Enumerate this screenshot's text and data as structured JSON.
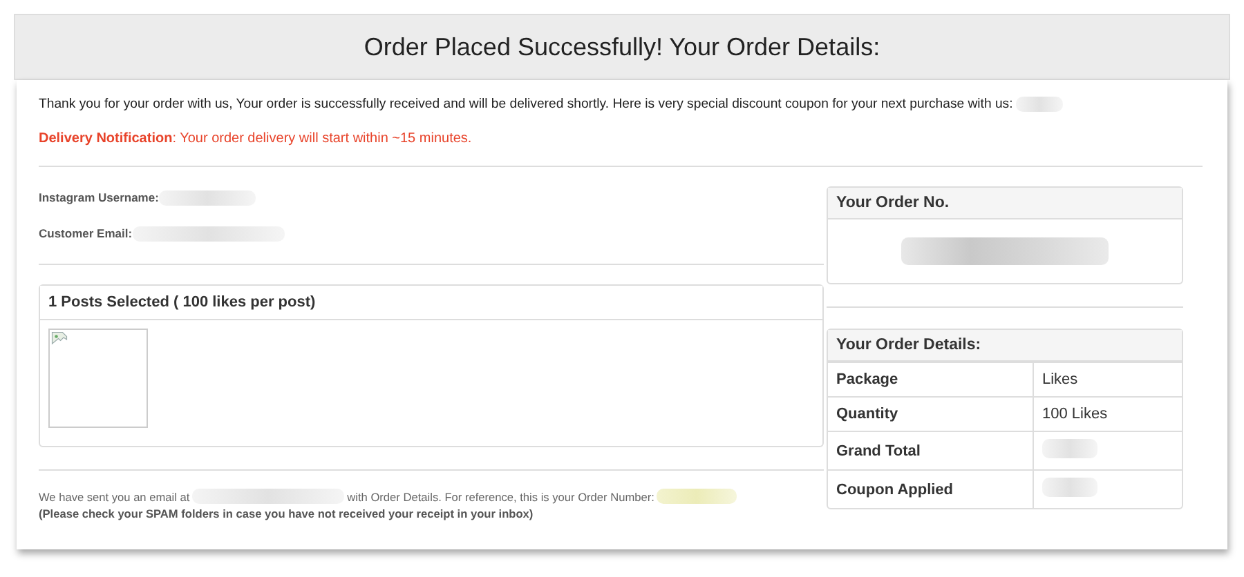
{
  "header": {
    "title": "Order Placed Successfully! Your Order Details:"
  },
  "intro": "Thank you for your order with us, Your order is successfully received and will be delivered shortly. Here is very special discount coupon for your next purchase with us:",
  "notification": "**Delivery Notification**: Your order delivery will start within ~15 minutes.",
  "customer": [
    {
      "label": "Instagram Username:"
    },
    {
      "label": "Customer Email:"
    }
  ],
  "posts_panel": {
    "title": "1 Posts Selected ( 100 likes per post)"
  },
  "order_no_panel": {
    "title": "Your Order No."
  },
  "details_panel": {
    "title": "Your Order Details:",
    "rows": [
      {
        "label": "Package",
        "value": "Likes"
      },
      {
        "label": "Quantity",
        "value": "100 Likes"
      },
      {
        "label": "Grand Total"
      },
      {
        "label": "Coupon Applied"
      }
    ]
  },
  "footer": {
    "email_text": "We have sent you an email at",
    "reference_text": "with Order Details. For reference, this is your Order Number:",
    "spam_note": "(Please check your SPAM folders in case you have not received your receipt in your inbox)"
  }
}
